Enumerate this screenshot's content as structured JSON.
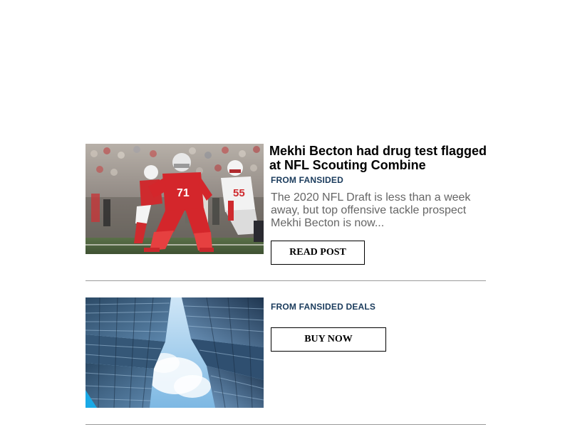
{
  "feed": {
    "items": [
      {
        "title": "Mekhi Becton had drug test flagged at NFL Scouting Combine",
        "source": "FROM FANSIDED",
        "excerpt": "The 2020 NFL Draft is less than a week away, but top offensive tackle prospect Mekhi Becton is now...",
        "button_label": "READ POST",
        "image": "football-game-photo",
        "jersey_primary": "71",
        "jersey_secondary": "55"
      },
      {
        "source": "FROM FANSIDED DEALS",
        "button_label": "BUY NOW",
        "image": "skyscrapers-photo"
      }
    ]
  },
  "colors": {
    "title": "#000000",
    "source": "#1a3b5c",
    "excerpt": "#666666",
    "divider": "#9a9a9a",
    "button_border": "#000000"
  }
}
